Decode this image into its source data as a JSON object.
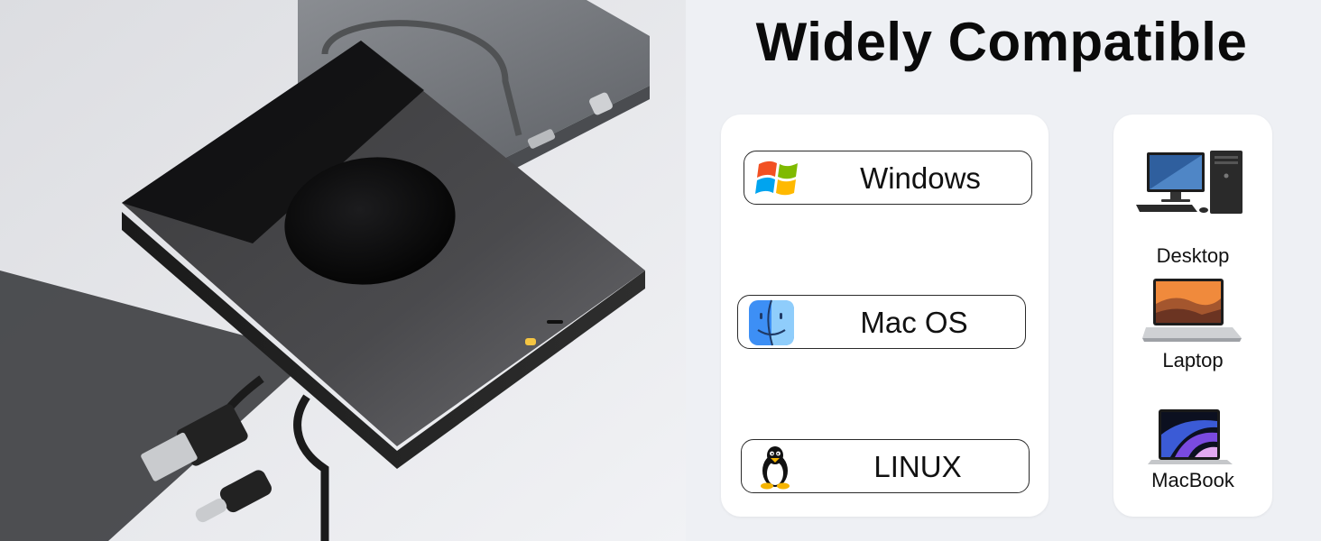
{
  "headline": "Widely Compatible",
  "operating_systems": [
    {
      "label": "Windows",
      "icon": "windows-logo-icon"
    },
    {
      "label": "Mac OS",
      "icon": "macos-finder-icon"
    },
    {
      "label": "LINUX",
      "icon": "linux-tux-icon"
    }
  ],
  "devices": [
    {
      "label": "Desktop",
      "icon": "desktop-computer-icon"
    },
    {
      "label": "Laptop",
      "icon": "laptop-icon"
    },
    {
      "label": "MacBook",
      "icon": "macbook-icon"
    }
  ],
  "colors": {
    "background": "#eef0f4",
    "panel": "#ffffff",
    "headline": "#0a0a0a",
    "drive_body": "#2b2b2b",
    "activity_led": "#f5c542"
  }
}
